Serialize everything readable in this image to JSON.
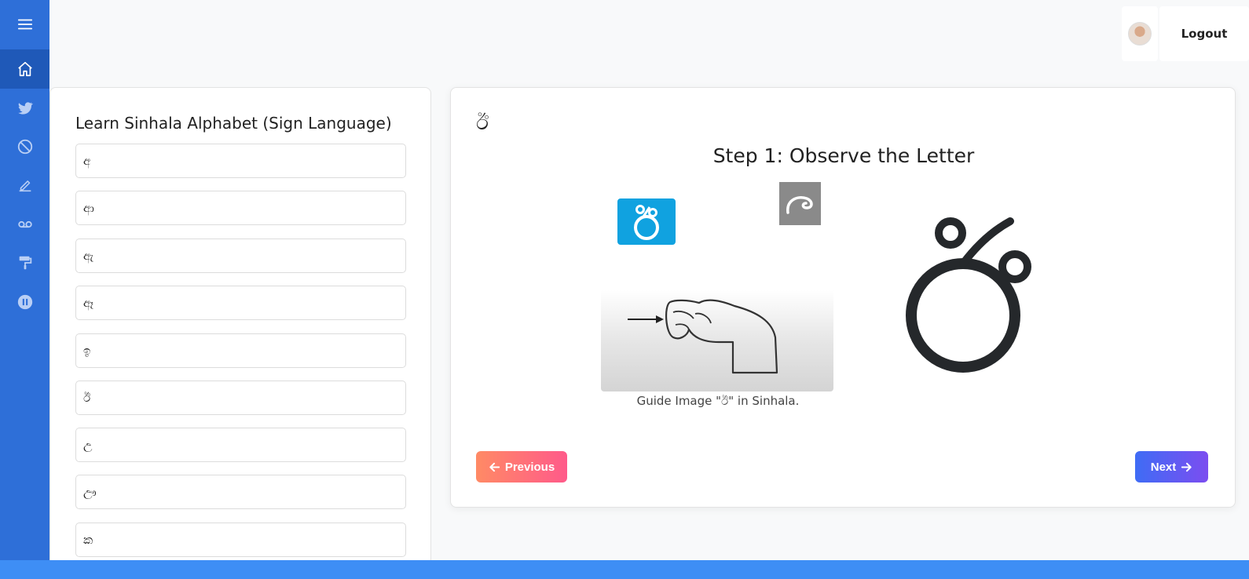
{
  "header": {
    "logout_label": "Logout"
  },
  "sidebar": {
    "items": [
      {
        "icon": "menu-icon"
      },
      {
        "icon": "home-icon",
        "active": true
      },
      {
        "icon": "twitter-icon"
      },
      {
        "icon": "ban-icon"
      },
      {
        "icon": "pencil-icon"
      },
      {
        "icon": "voicemail-icon"
      },
      {
        "icon": "paint-roller-icon"
      },
      {
        "icon": "pause-circle-icon"
      }
    ]
  },
  "alphabet_panel": {
    "title": "Learn Sinhala Alphabet (Sign Language)",
    "letters": [
      "අ",
      "ආ",
      "ඇ",
      "ඈ",
      "ඉ",
      "ඊ",
      "උ",
      "ඌ",
      "ක"
    ]
  },
  "lesson": {
    "current_letter": "ඊ",
    "step_title": "Step 1: Observe the Letter",
    "guide_caption": "Guide Image \"ඊ\" in Sinhala.",
    "previous_label": "Previous",
    "next_label": "Next"
  },
  "colors": {
    "sidebar": "#2e6fd8",
    "sidebar_active": "#1f59b8",
    "tile_blue": "#10a2e0",
    "prev_gradient": [
      "#ff8a65",
      "#ff5a8a"
    ],
    "next_gradient": [
      "#3f6cf5",
      "#7c4df0"
    ],
    "bottom_bar": "#3e8ef5"
  }
}
